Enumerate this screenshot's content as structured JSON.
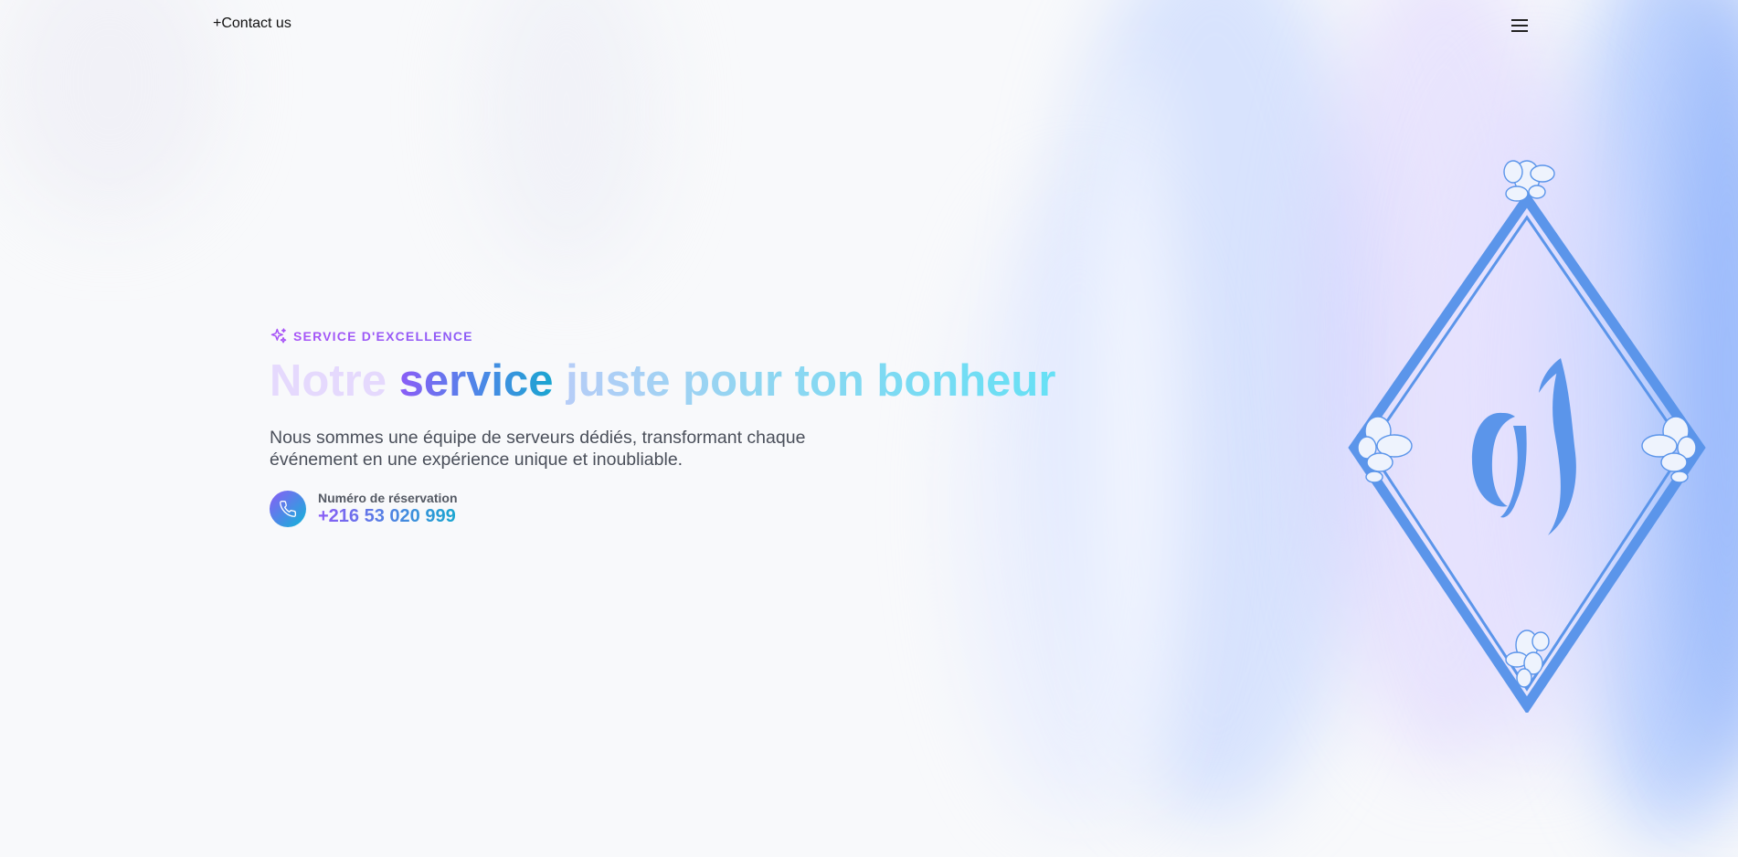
{
  "header": {
    "contact_label": "+Contact us",
    "menu_icon": "hamburger-menu-icon"
  },
  "hero": {
    "badge": {
      "icon": "sparkle-icon",
      "text": "SERVICE D'EXCELLENCE"
    },
    "headline": {
      "word1": "Notre",
      "word2": "service",
      "word3": "juste pour ton bonheur"
    },
    "description": "Nous sommes une équipe de serveurs dédiés, transformant chaque événement en une expérience unique et inoubliable.",
    "phone": {
      "icon": "phone-icon",
      "label": "Numéro de réservation",
      "number": "+216 53 020 999"
    }
  },
  "logo": {
    "icon": "diamond-monogram-logo"
  },
  "colors": {
    "accent_purple": "#8b5cf6",
    "accent_cyan": "#19a6d0",
    "logo_blue": "#5b95ea"
  }
}
